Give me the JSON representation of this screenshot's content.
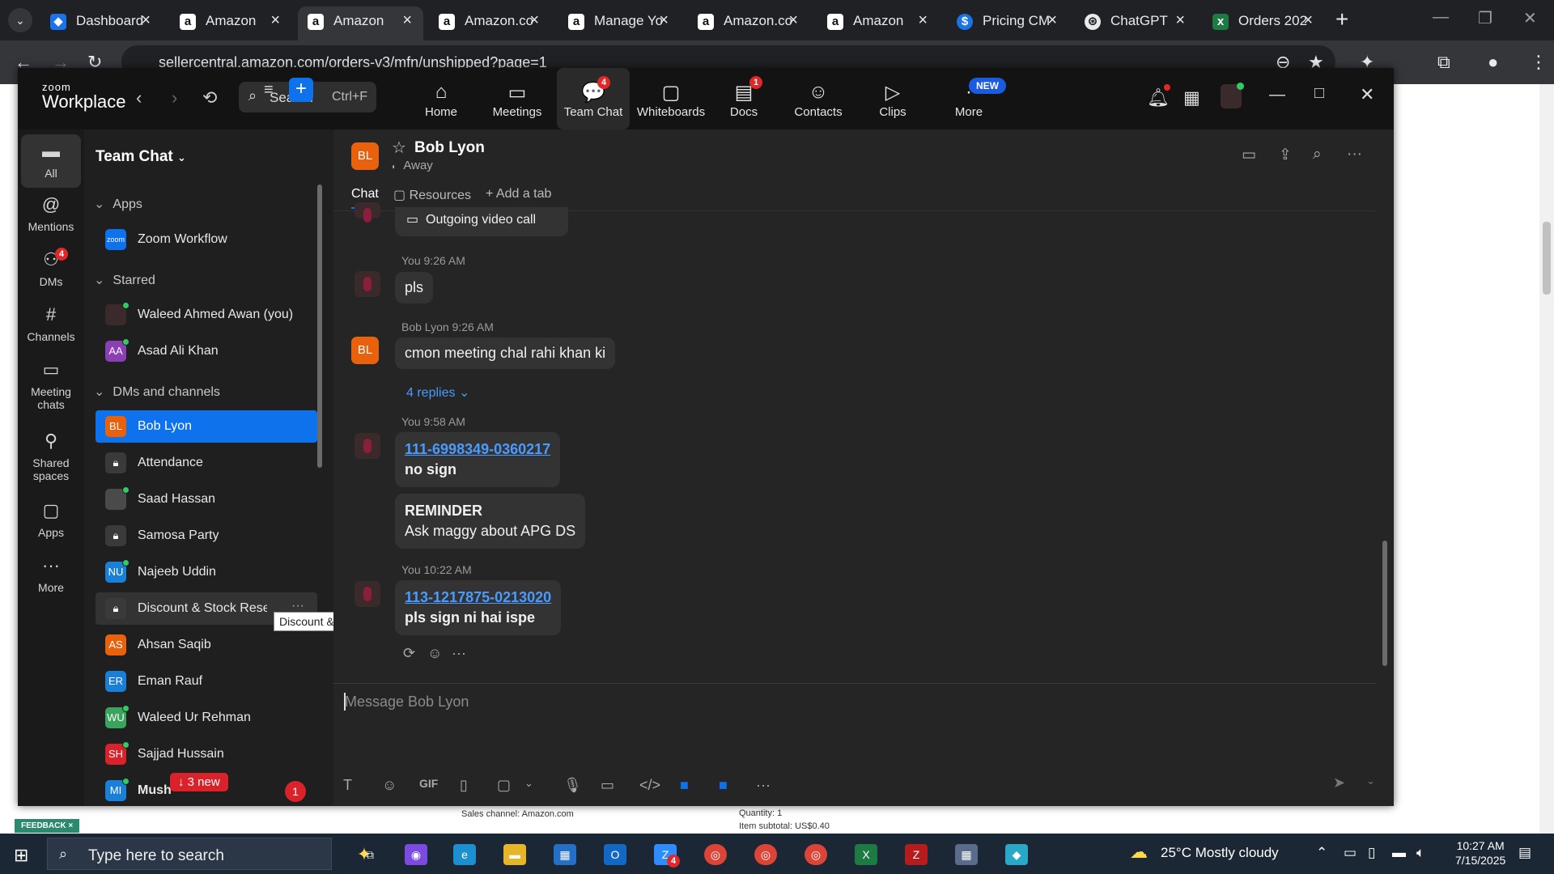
{
  "browser": {
    "tabs": [
      {
        "title": "Dashboard",
        "active": false
      },
      {
        "title": "Amazon",
        "active": false
      },
      {
        "title": "Amazon",
        "active": true
      },
      {
        "title": "Amazon.co",
        "active": false
      },
      {
        "title": "Manage Yo",
        "active": false
      },
      {
        "title": "Amazon.co",
        "active": false
      },
      {
        "title": "Amazon",
        "active": false
      },
      {
        "title": "Pricing CM",
        "active": false
      },
      {
        "title": "ChatGPT",
        "active": false
      },
      {
        "title": "Orders 202",
        "active": false
      }
    ],
    "url": "sellercentral.amazon.com/orders-v3/mfn/unshipped?page=1"
  },
  "background_page": {
    "sales_channel": "Sales channel: Amazon.com",
    "quantity": "Quantity: 1",
    "item_subtotal": "Item subtotal: US$0.40",
    "feedback": "FEEDBACK"
  },
  "zoom": {
    "logo_top": "zoom",
    "logo_bottom": "Workplace",
    "search_label": "Search",
    "search_shortcut": "Ctrl+F",
    "nav": [
      {
        "label": "Home",
        "icon": "home-icon"
      },
      {
        "label": "Meetings",
        "icon": "video-icon"
      },
      {
        "label": "Team Chat",
        "icon": "chat-icon",
        "badge": "4"
      },
      {
        "label": "Whiteboards",
        "icon": "whiteboard-icon"
      },
      {
        "label": "Docs",
        "icon": "doc-icon",
        "badge": "1"
      },
      {
        "label": "Contacts",
        "icon": "contacts-icon"
      },
      {
        "label": "Clips",
        "icon": "clips-icon"
      },
      {
        "label": "More",
        "icon": "more-icon"
      }
    ],
    "new_badge": "NEW"
  },
  "rail": [
    {
      "label": "All",
      "icon": "chat-bubble-icon"
    },
    {
      "label": "Mentions",
      "icon": "at-icon"
    },
    {
      "label": "DMs",
      "icon": "people-icon",
      "badge": "4"
    },
    {
      "label": "Channels",
      "icon": "hash-icon"
    },
    {
      "label": "Meeting chats",
      "icon": "calendar-icon"
    },
    {
      "label": "Shared spaces",
      "icon": "share-icon"
    },
    {
      "label": "Apps",
      "icon": "apps-icon"
    },
    {
      "label": "More",
      "icon": "dots-icon"
    }
  ],
  "list": {
    "title": "Team Chat",
    "sections": {
      "apps": "Apps",
      "starred": "Starred",
      "dms": "DMs and channels"
    },
    "apps_items": [
      {
        "name": "Zoom Workflow",
        "avatar": "zoom",
        "color": "#0e72ed"
      }
    ],
    "starred_items": [
      {
        "name": "Waleed Ahmed Awan (you)",
        "avatar": "",
        "color": "#3b2a2c"
      },
      {
        "name": "Asad Ali Khan",
        "avatar": "AA",
        "color": "#8a3fb3"
      }
    ],
    "dm_items": [
      {
        "name": "Bob Lyon",
        "avatar": "BL",
        "color": "#e8610d"
      },
      {
        "name": "Attendance",
        "avatar": "🔒",
        "color": "#3a3a3a"
      },
      {
        "name": "Saad Hassan",
        "avatar": "",
        "color": "#4a4a4a"
      },
      {
        "name": "Samosa Party",
        "avatar": "🔒",
        "color": "#3a3a3a"
      },
      {
        "name": "Najeeb Uddin",
        "avatar": "NU",
        "color": "#1a7fd6"
      },
      {
        "name": "Discount & Stock Reser",
        "avatar": "🔒",
        "color": "#3a3a3a"
      },
      {
        "name": "Ahsan Saqib",
        "avatar": "AS",
        "color": "#e8610d"
      },
      {
        "name": "Eman Rauf",
        "avatar": "ER",
        "color": "#1a7fd6"
      },
      {
        "name": "Waleed Ur Rehman",
        "avatar": "WU",
        "color": "#3aa35c"
      },
      {
        "name": "Sajjad Hussain",
        "avatar": "SH",
        "color": "#d9222a"
      },
      {
        "name": "Mush",
        "avatar": "MI",
        "color": "#1a7fd6"
      }
    ],
    "tooltip": "Discount & Stock Reservation Requests Only",
    "new_pill": "↓ 3 new",
    "unread_count": "1"
  },
  "chat": {
    "contact_name": "Bob Lyon",
    "contact_avatar": "BL",
    "status": "Away",
    "tabs": [
      "Chat",
      "Resources",
      "+ Add a tab"
    ],
    "outgoing_call": "Outgoing video call",
    "messages": [
      {
        "meta": "You 9:26 AM",
        "text": "pls"
      },
      {
        "meta": "Bob Lyon 9:26 AM",
        "text": "cmon meeting chal rahi khan ki",
        "replies": "4 replies"
      },
      {
        "meta": "You 9:58 AM",
        "link": "111-6998349-0360217",
        "text": "no sign"
      },
      {
        "title": "REMINDER",
        "text": "Ask maggy about APG DS"
      },
      {
        "meta": "You 10:22 AM",
        "link": "113-1217875-0213020",
        "text": "pls sign ni hai ispe"
      }
    ],
    "composer_placeholder": "Message Bob Lyon",
    "composer_tools": {
      "gif": "GIF"
    }
  },
  "taskbar": {
    "search_placeholder": "Type here to search",
    "weather": "25°C  Mostly cloudy",
    "time": "10:27 AM",
    "date": "7/15/2025",
    "outlook_badge": "4"
  }
}
